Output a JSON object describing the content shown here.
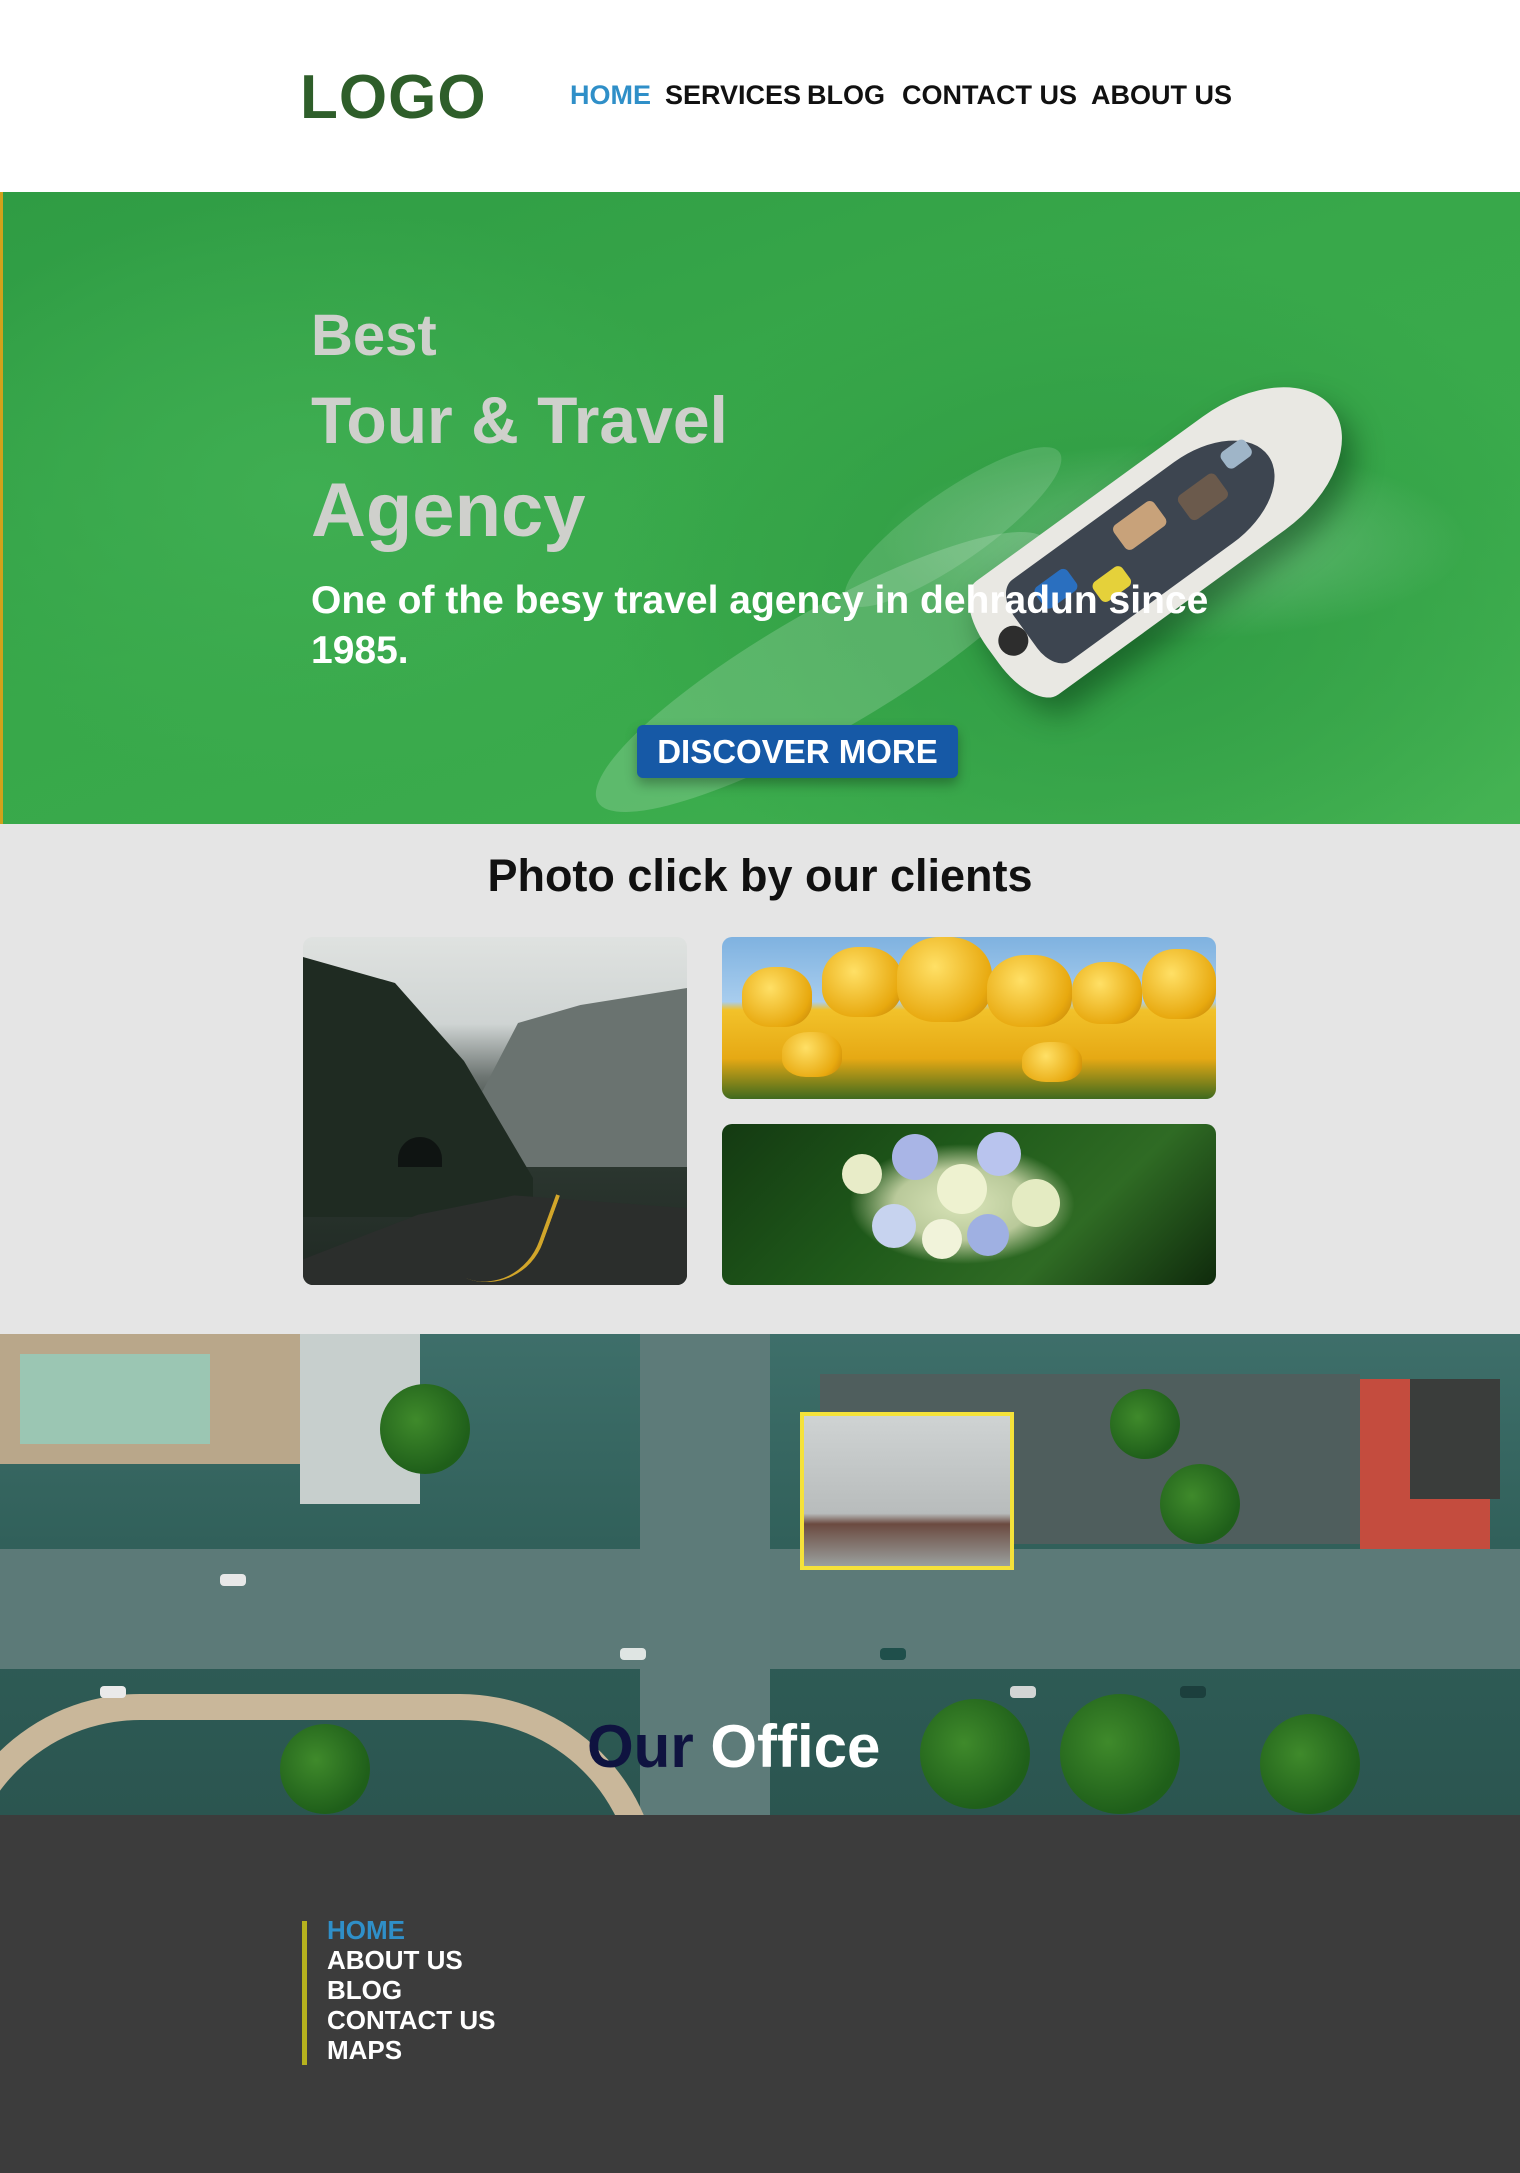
{
  "header": {
    "logo": "LOGO",
    "nav": [
      {
        "label": "HOME",
        "active": true
      },
      {
        "label": "SERVICES",
        "active": false
      },
      {
        "label": "BLOG",
        "active": false
      },
      {
        "label": "CONTACT US",
        "active": false
      },
      {
        "label": "ABOUT US",
        "active": false
      }
    ]
  },
  "hero": {
    "title_line1": "Best",
    "title_line2": "Tour & Travel",
    "title_line3": "Agency",
    "subtitle": "One of the besy travel agency in dehradun since 1985.",
    "button_label": "DISCOVER MORE"
  },
  "gallery": {
    "title": "Photo click by our clients",
    "photos": [
      {
        "icon": "mountain-road-photo"
      },
      {
        "icon": "yellow-tulips-photo"
      },
      {
        "icon": "hydrangea-flowers-photo"
      }
    ]
  },
  "office": {
    "title_word1": "Our",
    "title_word2": "Office"
  },
  "footer": {
    "links": [
      {
        "label": "HOME",
        "active": true
      },
      {
        "label": "ABOUT US",
        "active": false
      },
      {
        "label": "BLOG",
        "active": false
      },
      {
        "label": "CONTACT US",
        "active": false
      },
      {
        "label": "MAPS",
        "active": false
      }
    ]
  },
  "colors": {
    "brand_green": "#2e5e2a",
    "accent_blue": "#2f8fc8",
    "button_blue": "#1659a6",
    "footer_bg": "#3c3c3c",
    "footer_accent": "#b6b21e"
  }
}
